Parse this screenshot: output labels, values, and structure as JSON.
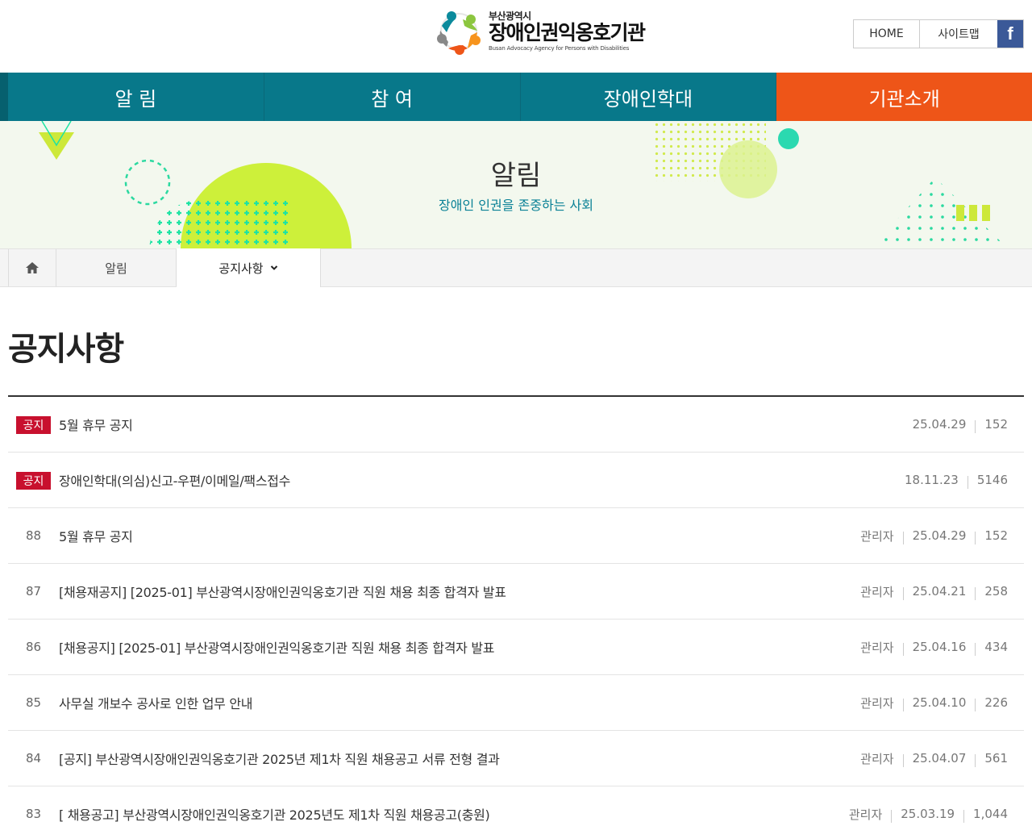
{
  "header": {
    "logo_sub": "부산광역시",
    "logo_main": "장애인권익옹호기관",
    "logo_eng": "Busan Advocacy Agency for Persons with Disabilities",
    "util": {
      "home": "HOME",
      "sitemap": "사이트맵",
      "facebook": "f"
    }
  },
  "gnb": [
    {
      "label": "알 림",
      "active": false
    },
    {
      "label": "참 여",
      "active": false
    },
    {
      "label": "장애인학대",
      "active": false
    },
    {
      "label": "기관소개",
      "active": true
    }
  ],
  "visual": {
    "title": "알림",
    "subtitle": "장애인 인권을 존중하는 사회"
  },
  "location": {
    "depth1": "알림",
    "depth2": "공지사항"
  },
  "page_title": "공지사항",
  "board": {
    "notices": [
      {
        "badge": "공지",
        "subject": "5월 휴무 공지",
        "date": "25.04.29",
        "views": "152"
      },
      {
        "badge": "공지",
        "subject": "장애인학대(의심)신고-우편/이메일/팩스접수",
        "date": "18.11.23",
        "views": "5146"
      }
    ],
    "posts": [
      {
        "num": "88",
        "subject": "5월 휴무 공지",
        "author": "관리자",
        "date": "25.04.29",
        "views": "152"
      },
      {
        "num": "87",
        "subject": "[채용재공지] [2025-01] 부산광역시장애인권익옹호기관 직원 채용 최종 합격자 발표",
        "author": "관리자",
        "date": "25.04.21",
        "views": "258"
      },
      {
        "num": "86",
        "subject": "[채용공지] [2025-01] 부산광역시장애인권익옹호기관 직원 채용 최종 합격자 발표",
        "author": "관리자",
        "date": "25.04.16",
        "views": "434"
      },
      {
        "num": "85",
        "subject": "사무실 개보수 공사로 인한 업무 안내",
        "author": "관리자",
        "date": "25.04.10",
        "views": "226"
      },
      {
        "num": "84",
        "subject": "[공지] 부산광역시장애인권익옹호기관 2025년 제1차 직원 채용공고 서류 전형 결과",
        "author": "관리자",
        "date": "25.04.07",
        "views": "561"
      },
      {
        "num": "83",
        "subject": "[ 채용공고] 부산광역시장애인권익옹호기관 2025년도 제1차 직원 채용공고(충원)",
        "author": "관리자",
        "date": "25.03.19",
        "views": "1,044"
      }
    ]
  },
  "colors": {
    "gnb": "#08788a",
    "gnb_active": "#ee5518",
    "badge": "#c8102e",
    "accent_text": "#0a8196"
  }
}
